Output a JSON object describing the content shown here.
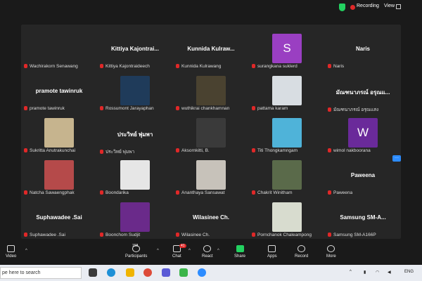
{
  "topbar": {
    "recording": "Recording",
    "view": "View"
  },
  "more_button": "···",
  "tiles": [
    {
      "label": "Wachirakorn Senawang",
      "center": "",
      "pic": ""
    },
    {
      "label": "Kittiya Kajontraideech",
      "center": "Kittiya  Kajontrai...",
      "pic": ""
    },
    {
      "label": "Kunnida Kulrawang",
      "center": "Kunnida  Kulraw...",
      "pic": ""
    },
    {
      "label": "surangkana suklerd",
      "center": "",
      "pic": "#9a3fc2",
      "initial": "S"
    },
    {
      "label": "Naris",
      "center": "Naris",
      "pic": ""
    },
    {
      "label": "pramote tawinruk",
      "center": "pramote tawinruk",
      "pic": ""
    },
    {
      "label": "Rossumont Jarayaphan",
      "center": "",
      "pic": "#1f3b5a"
    },
    {
      "label": "wuthikrai chankhamnan",
      "center": "",
      "pic": "#4a4230"
    },
    {
      "label": "pattama karam",
      "center": "",
      "pic": "#d8dde2"
    },
    {
      "label": "มัณฑนาภรณ์ อรุณแสง",
      "center": "มัณฑนาภรณ์ อรุณแ...",
      "pic": ""
    },
    {
      "label": "Sukritta Anutrakunchai",
      "center": "",
      "pic": "#c6b48e"
    },
    {
      "label": "ประวิทย์ พุ่มพา",
      "center": "ประวิทย์  พุ่มพา",
      "pic": ""
    },
    {
      "label": "Aksornkitti, B.",
      "center": "",
      "pic": "#3a3a3a"
    },
    {
      "label": "Titi Thongkamngam",
      "center": "",
      "pic": "#4fb3d9"
    },
    {
      "label": "wimol nakboorana",
      "center": "",
      "pic": "#6a2a9a",
      "initial": "W"
    },
    {
      "label": "Natcha Sawaengphak",
      "center": "",
      "pic": "#b54a4a"
    },
    {
      "label": "Boondarika",
      "center": "",
      "pic": "#e6e6e6"
    },
    {
      "label": "Ananthaya Sansawat",
      "center": "",
      "pic": "#c7c2ba"
    },
    {
      "label": "Chakrit Winitham",
      "center": "",
      "pic": "#5a6a4a"
    },
    {
      "label": "Paweena",
      "center": "Paweena",
      "pic": ""
    },
    {
      "label": "Suphawadee .Sai",
      "center": "Suphawadee .Sai",
      "pic": ""
    },
    {
      "label": "Boonchom Sudjit",
      "center": "",
      "pic": "#6a2a8a"
    },
    {
      "label": "Wilasinee Ch.",
      "center": "Wilasinee Ch.",
      "pic": ""
    },
    {
      "label": "Pornchanok Chaleampong",
      "center": "",
      "pic": "#d8dccf"
    },
    {
      "label": "Samsung SM-A166P",
      "center": "Samsung  SM-A...",
      "pic": ""
    }
  ],
  "toolbar": {
    "video": "Video",
    "participants": "Participants",
    "participants_count": "158",
    "chat": "Chat",
    "chat_badge": "41",
    "react": "React",
    "share": "Share",
    "apps": "Apps",
    "record": "Record",
    "more": "More"
  },
  "taskbar": {
    "search_placeholder": "pe here to search",
    "lang": "ENG"
  }
}
